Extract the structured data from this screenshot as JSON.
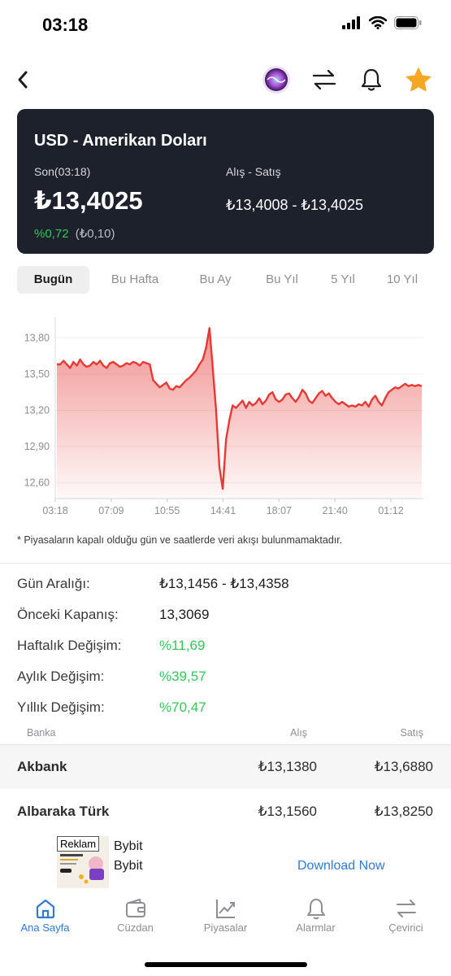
{
  "status": {
    "time": "03:18"
  },
  "hero": {
    "title": "USD - Amerikan Doları",
    "last_label": "Son(03:18)",
    "price": "₺13,4025",
    "change_pct": "%0,72",
    "change_abs": "(₺0,10)",
    "buy_sell_label": "Alış - Satış",
    "buy_sell_value": "₺13,4008 - ₺13,4025"
  },
  "periods": [
    "Bugün",
    "Bu Hafta",
    "Bu Ay",
    "Bu Yıl",
    "5 Yıl",
    "10 Yıl"
  ],
  "chart_data": {
    "type": "area",
    "x_ticks": [
      "03:18",
      "07:09",
      "10:55",
      "14:41",
      "18:07",
      "21:40",
      "01:12"
    ],
    "y_ticks": [
      "13,80",
      "13,50",
      "13,20",
      "12,90",
      "12,60"
    ],
    "ylim": [
      12.47,
      13.97
    ],
    "series": [
      {
        "values": [
          13.58,
          13.58,
          13.61,
          13.58,
          13.55,
          13.6,
          13.57,
          13.62,
          13.58,
          13.56,
          13.57,
          13.6,
          13.58,
          13.61,
          13.57,
          13.55,
          13.59,
          13.6,
          13.58,
          13.56,
          13.57,
          13.59,
          13.58,
          13.6,
          13.59,
          13.57,
          13.6,
          13.59,
          13.58,
          13.45,
          13.42,
          13.39,
          13.41,
          13.43,
          13.38,
          13.37,
          13.4,
          13.39,
          13.42,
          13.45,
          13.47,
          13.5,
          13.53,
          13.58,
          13.62,
          13.72,
          13.88,
          13.55,
          13.2,
          12.73,
          12.55,
          12.96,
          13.12,
          13.24,
          13.22,
          13.25,
          13.28,
          13.22,
          13.27,
          13.24,
          13.26,
          13.3,
          13.25,
          13.28,
          13.33,
          13.35,
          13.29,
          13.27,
          13.29,
          13.33,
          13.34,
          13.3,
          13.27,
          13.31,
          13.37,
          13.34,
          13.28,
          13.26,
          13.3,
          13.34,
          13.36,
          13.32,
          13.34,
          13.3,
          13.27,
          13.25,
          13.27,
          13.25,
          13.23,
          13.24,
          13.23,
          13.25,
          13.24,
          13.27,
          13.23,
          13.29,
          13.32,
          13.27,
          13.24,
          13.3,
          13.35,
          13.37,
          13.39,
          13.38,
          13.4,
          13.42,
          13.4,
          13.41,
          13.4,
          13.41,
          13.4
        ]
      }
    ]
  },
  "chart_note": "* Piyasaların kapalı olduğu gün ve saatlerde veri akışı bulunmamaktadır.",
  "stats": [
    {
      "label": "Gün Aralığı:",
      "value": "₺13,1456 - ₺13,4358",
      "color": "#1c1c1e"
    },
    {
      "label": "Önceki Kapanış:",
      "value": "13,3069",
      "color": "#1c1c1e"
    },
    {
      "label": "Haftalık Değişim:",
      "value": "%11,69",
      "color": "#34c759"
    },
    {
      "label": "Aylık Değişim:",
      "value": "%39,57",
      "color": "#34c759"
    },
    {
      "label": "Yıllık Değişim:",
      "value": "%70,47",
      "color": "#34c759"
    }
  ],
  "bank_table": {
    "headers": {
      "bank": "Banka",
      "buy": "Alış",
      "sell": "Satış"
    },
    "rows": [
      {
        "name": "Akbank",
        "buy": "₺13,1380",
        "sell": "₺13,6880"
      },
      {
        "name": "Albaraka Türk",
        "buy": "₺13,1560",
        "sell": "₺13,8250"
      }
    ]
  },
  "ad": {
    "tag": "Reklam",
    "brand_line1": "Bybit",
    "brand_line2": "Bybit",
    "cta": "Download Now"
  },
  "tabs": [
    {
      "label": "Ana Sayfa",
      "icon": "home-icon",
      "active": true
    },
    {
      "label": "Cüzdan",
      "icon": "wallet-icon",
      "active": false
    },
    {
      "label": "Piyasalar",
      "icon": "chart-icon",
      "active": false
    },
    {
      "label": "Alarmlar",
      "icon": "bell-icon",
      "active": false
    },
    {
      "label": "Çevirici",
      "icon": "swap-icon",
      "active": false
    }
  ],
  "colors": {
    "accent": "#2f7ad8",
    "up": "#34c759",
    "chart_line": "#e53935",
    "hero_bg": "#1d212b",
    "star": "#f5a623"
  }
}
